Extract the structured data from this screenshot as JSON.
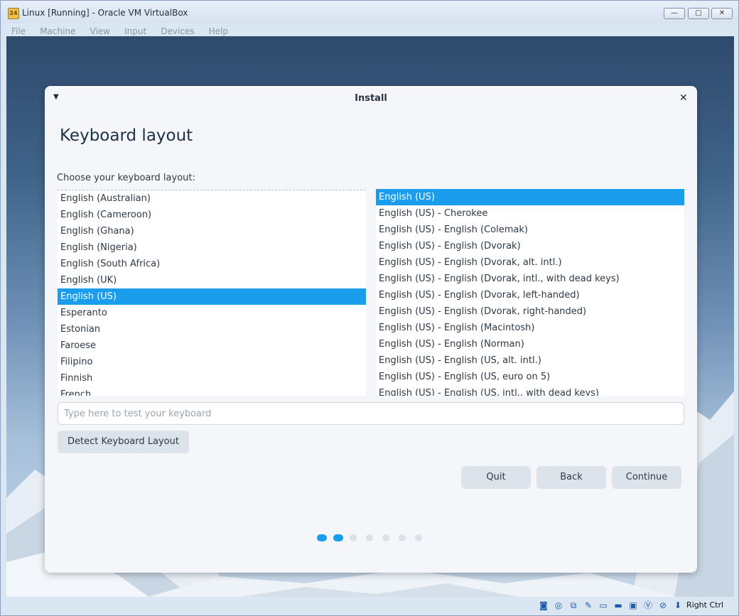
{
  "window": {
    "title": "Linux [Running] - Oracle VM VirtualBox",
    "buttons": {
      "minimize": "—",
      "maximize": "▢",
      "close": "✕"
    }
  },
  "menubar": [
    "File",
    "Machine",
    "View",
    "Input",
    "Devices",
    "Help"
  ],
  "installer": {
    "dialog_title": "Install",
    "page_title": "Keyboard layout",
    "prompt": "Choose your keyboard layout:",
    "layouts": [
      "English (Australian)",
      "English (Cameroon)",
      "English (Ghana)",
      "English (Nigeria)",
      "English (South Africa)",
      "English (UK)",
      "English (US)",
      "Esperanto",
      "Estonian",
      "Faroese",
      "Filipino",
      "Finnish",
      "French"
    ],
    "selected_layout": "English (US)",
    "variants": [
      "English (US)",
      "English (US) - Cherokee",
      "English (US) - English (Colemak)",
      "English (US) - English (Dvorak)",
      "English (US) - English (Dvorak, alt. intl.)",
      "English (US) - English (Dvorak, intl., with dead keys)",
      "English (US) - English (Dvorak, left-handed)",
      "English (US) - English (Dvorak, right-handed)",
      "English (US) - English (Macintosh)",
      "English (US) - English (Norman)",
      "English (US) - English (US, alt. intl.)",
      "English (US) - English (US, euro on 5)",
      "English (US) - English (US, intl., with dead keys)"
    ],
    "selected_variant": "English (US)",
    "test_placeholder": "Type here to test your keyboard",
    "test_value": "",
    "detect_button": "Detect Keyboard Layout",
    "quit_button": "Quit",
    "back_button": "Back",
    "continue_button": "Continue",
    "progress": {
      "total_steps": 7,
      "completed_steps": 2
    }
  },
  "statusbar": {
    "host_key": "Right Ctrl",
    "icons": [
      "hard-disk-icon",
      "optical-drive-icon",
      "network-icon",
      "usb-icon",
      "shared-folders-icon",
      "display-icon",
      "video-capture-icon",
      "vt-x-icon",
      "mouse-integration-icon",
      "keyboard-capture-icon"
    ]
  },
  "colors": {
    "accent": "#1a9ded",
    "dialog_bg": "#f4f6f9"
  }
}
